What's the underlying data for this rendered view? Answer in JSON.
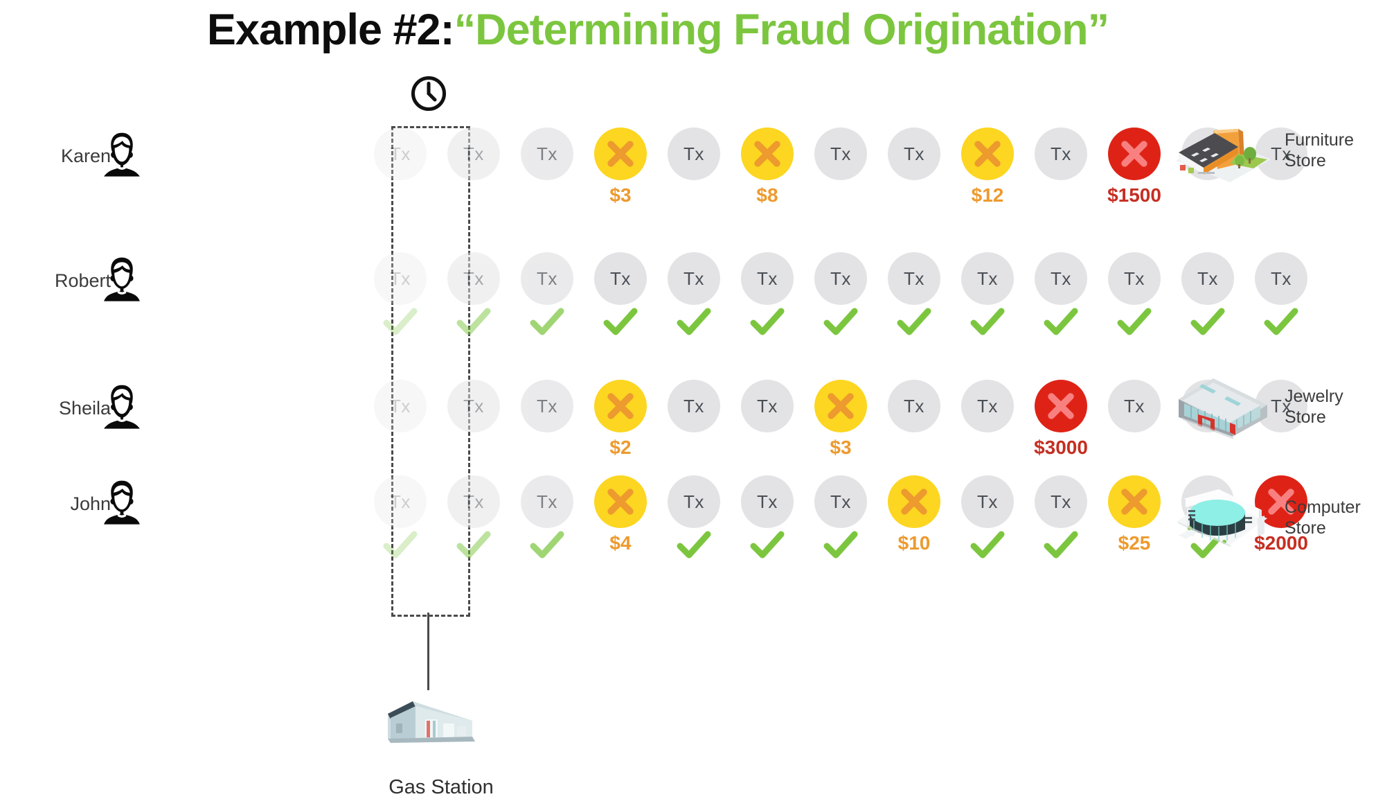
{
  "title": {
    "prefix": "Example #2:",
    "highlight": "“Determining Fraud Origination”",
    "prefix_color": "#0d0d0d",
    "highlight_color": "#7CC63F"
  },
  "legend": {
    "tx_label": "Tx",
    "clock_icon": "clock-icon",
    "highlight_box": "dashed-highlight-column"
  },
  "colors": {
    "gray_circle": "#E3E3E5",
    "yellow_circle": "#FCD621",
    "red_circle": "#DE2316",
    "orange_x": "#ED9A2E",
    "pink_x": "#F98080",
    "green_check": "#7CC63F",
    "small_amount_text": "#ED9A2E",
    "big_amount_text": "#C62E22",
    "tx_text": "#4A4F56"
  },
  "common_origin": {
    "merchant": "Gas Station",
    "icon": "gas-station-icon",
    "column_index": 4
  },
  "rows": [
    {
      "name": "Karen",
      "avatar": "female-avatar-icon",
      "merchant": {
        "label": "Furniture\nStore",
        "icon": "furniture-store-icon"
      },
      "cells": [
        {
          "type": "gray",
          "label": "Tx",
          "fade": 0,
          "amount": null,
          "check": false
        },
        {
          "type": "gray",
          "label": "Tx",
          "fade": 1,
          "amount": null,
          "check": false
        },
        {
          "type": "gray",
          "label": "Tx",
          "fade": 2,
          "amount": null,
          "check": false
        },
        {
          "type": "yellow",
          "label": "",
          "fade": 3,
          "amount": "$3",
          "amount_size": "small",
          "check": false
        },
        {
          "type": "gray",
          "label": "Tx",
          "fade": 3,
          "amount": null,
          "check": false
        },
        {
          "type": "yellow",
          "label": "",
          "fade": 3,
          "amount": "$8",
          "amount_size": "small",
          "check": false
        },
        {
          "type": "gray",
          "label": "Tx",
          "fade": 3,
          "amount": null,
          "check": false
        },
        {
          "type": "gray",
          "label": "Tx",
          "fade": 3,
          "amount": null,
          "check": false
        },
        {
          "type": "yellow",
          "label": "",
          "fade": 3,
          "amount": "$12",
          "amount_size": "small",
          "check": false
        },
        {
          "type": "gray",
          "label": "Tx",
          "fade": 3,
          "amount": null,
          "check": false
        },
        {
          "type": "red",
          "label": "",
          "fade": 3,
          "amount": "$1500",
          "amount_size": "big",
          "check": false
        },
        {
          "type": "gray",
          "label": "Tx",
          "fade": 3,
          "amount": null,
          "check": false
        },
        {
          "type": "gray",
          "label": "Tx",
          "fade": 3,
          "amount": null,
          "check": false
        }
      ]
    },
    {
      "name": "Robert",
      "avatar": "male-avatar-icon",
      "merchant": null,
      "cells": [
        {
          "type": "gray",
          "label": "Tx",
          "fade": 0,
          "amount": null,
          "check": true
        },
        {
          "type": "gray",
          "label": "Tx",
          "fade": 1,
          "amount": null,
          "check": true
        },
        {
          "type": "gray",
          "label": "Tx",
          "fade": 2,
          "amount": null,
          "check": true
        },
        {
          "type": "gray",
          "label": "Tx",
          "fade": 3,
          "amount": null,
          "check": true
        },
        {
          "type": "gray",
          "label": "Tx",
          "fade": 3,
          "amount": null,
          "check": true
        },
        {
          "type": "gray",
          "label": "Tx",
          "fade": 3,
          "amount": null,
          "check": true
        },
        {
          "type": "gray",
          "label": "Tx",
          "fade": 3,
          "amount": null,
          "check": true
        },
        {
          "type": "gray",
          "label": "Tx",
          "fade": 3,
          "amount": null,
          "check": true
        },
        {
          "type": "gray",
          "label": "Tx",
          "fade": 3,
          "amount": null,
          "check": true
        },
        {
          "type": "gray",
          "label": "Tx",
          "fade": 3,
          "amount": null,
          "check": true
        },
        {
          "type": "gray",
          "label": "Tx",
          "fade": 3,
          "amount": null,
          "check": true
        },
        {
          "type": "gray",
          "label": "Tx",
          "fade": 3,
          "amount": null,
          "check": true
        },
        {
          "type": "gray",
          "label": "Tx",
          "fade": 3,
          "amount": null,
          "check": true
        }
      ]
    },
    {
      "name": "Sheila",
      "avatar": "female-avatar-icon",
      "merchant": {
        "label": "Jewelry\nStore",
        "icon": "jewelry-store-icon"
      },
      "cells": [
        {
          "type": "gray",
          "label": "Tx",
          "fade": 0,
          "amount": null,
          "check": false
        },
        {
          "type": "gray",
          "label": "Tx",
          "fade": 1,
          "amount": null,
          "check": false
        },
        {
          "type": "gray",
          "label": "Tx",
          "fade": 2,
          "amount": null,
          "check": false
        },
        {
          "type": "yellow",
          "label": "",
          "fade": 3,
          "amount": "$2",
          "amount_size": "small",
          "check": false
        },
        {
          "type": "gray",
          "label": "Tx",
          "fade": 3,
          "amount": null,
          "check": false
        },
        {
          "type": "gray",
          "label": "Tx",
          "fade": 3,
          "amount": null,
          "check": false
        },
        {
          "type": "yellow",
          "label": "",
          "fade": 3,
          "amount": "$3",
          "amount_size": "small",
          "check": false
        },
        {
          "type": "gray",
          "label": "Tx",
          "fade": 3,
          "amount": null,
          "check": false
        },
        {
          "type": "gray",
          "label": "Tx",
          "fade": 3,
          "amount": null,
          "check": false
        },
        {
          "type": "red",
          "label": "",
          "fade": 3,
          "amount": "$3000",
          "amount_size": "big",
          "check": false
        },
        {
          "type": "gray",
          "label": "Tx",
          "fade": 3,
          "amount": null,
          "check": false
        },
        {
          "type": "gray",
          "label": "Tx",
          "fade": 3,
          "amount": null,
          "check": false
        },
        {
          "type": "gray",
          "label": "Tx",
          "fade": 3,
          "amount": null,
          "check": false
        }
      ]
    },
    {
      "name": "John",
      "avatar": "male-avatar-icon",
      "merchant": {
        "label": "Computer\nStore",
        "icon": "computer-store-icon"
      },
      "cells": [
        {
          "type": "gray",
          "label": "Tx",
          "fade": 0,
          "amount": null,
          "check": true
        },
        {
          "type": "gray",
          "label": "Tx",
          "fade": 1,
          "amount": null,
          "check": true
        },
        {
          "type": "gray",
          "label": "Tx",
          "fade": 2,
          "amount": null,
          "check": true
        },
        {
          "type": "yellow",
          "label": "",
          "fade": 3,
          "amount": "$4",
          "amount_size": "small",
          "check": false
        },
        {
          "type": "gray",
          "label": "Tx",
          "fade": 3,
          "amount": null,
          "check": true
        },
        {
          "type": "gray",
          "label": "Tx",
          "fade": 3,
          "amount": null,
          "check": true
        },
        {
          "type": "gray",
          "label": "Tx",
          "fade": 3,
          "amount": null,
          "check": true
        },
        {
          "type": "yellow",
          "label": "",
          "fade": 3,
          "amount": "$10",
          "amount_size": "small",
          "check": false
        },
        {
          "type": "gray",
          "label": "Tx",
          "fade": 3,
          "amount": null,
          "check": true
        },
        {
          "type": "gray",
          "label": "Tx",
          "fade": 3,
          "amount": null,
          "check": true
        },
        {
          "type": "yellow",
          "label": "",
          "fade": 3,
          "amount": "$25",
          "amount_size": "small",
          "check": false
        },
        {
          "type": "gray",
          "label": "Tx",
          "fade": 3,
          "amount": null,
          "check": true
        },
        {
          "type": "red",
          "label": "",
          "fade": 3,
          "amount": "$2000",
          "amount_size": "big",
          "check": false
        }
      ]
    }
  ]
}
